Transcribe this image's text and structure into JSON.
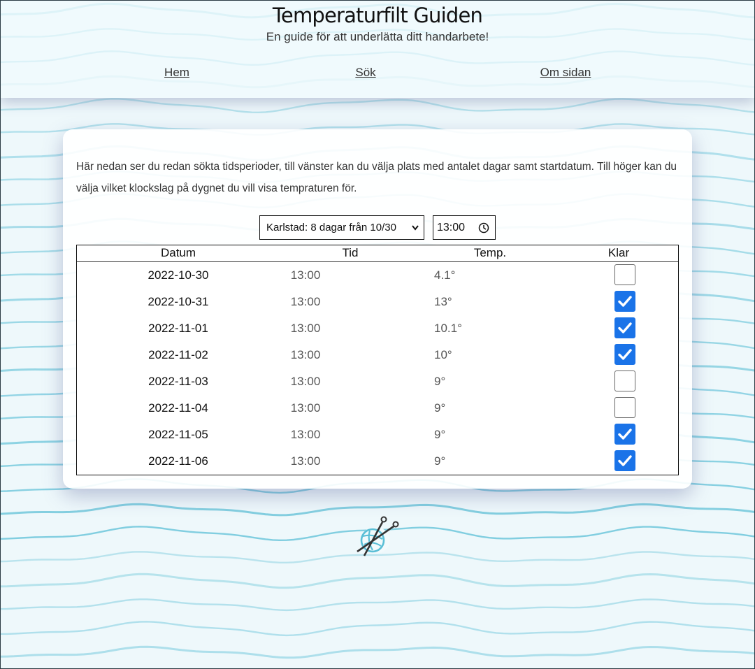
{
  "header": {
    "title": "Temperaturfilt Guiden",
    "subtitle": "En guide för att underlätta ditt handarbete!"
  },
  "nav": [
    {
      "label": "Hem"
    },
    {
      "label": "Sök"
    },
    {
      "label": "Om sidan"
    }
  ],
  "main": {
    "intro": "Här nedan ser du redan sökta tidsperioder, till vänster kan du välja plats med antalet dagar samt startdatum. Till höger kan du välja vilket klockslag på dygnet du vill visa tempraturen för.",
    "period_select": {
      "selected": "Karlstad: 8 dagar från 10/30"
    },
    "time_input": {
      "value": "13:00"
    }
  },
  "table": {
    "headers": {
      "date": "Datum",
      "time": "Tid",
      "temp": "Temp.",
      "done": "Klar"
    },
    "rows": [
      {
        "date": "2022-10-30",
        "time": "13:00",
        "temp": "4.1°",
        "done": false
      },
      {
        "date": "2022-10-31",
        "time": "13:00",
        "temp": "13°",
        "done": true
      },
      {
        "date": "2022-11-01",
        "time": "13:00",
        "temp": "10.1°",
        "done": true
      },
      {
        "date": "2022-11-02",
        "time": "13:00",
        "temp": "10°",
        "done": true
      },
      {
        "date": "2022-11-03",
        "time": "13:00",
        "temp": "9°",
        "done": false
      },
      {
        "date": "2022-11-04",
        "time": "13:00",
        "temp": "9°",
        "done": false
      },
      {
        "date": "2022-11-05",
        "time": "13:00",
        "temp": "9°",
        "done": true
      },
      {
        "date": "2022-11-06",
        "time": "13:00",
        "temp": "9°",
        "done": true
      }
    ]
  },
  "icons": {
    "logo": "yarn-ball-knitting-needles-icon",
    "select_arrow": "chevron-down-icon",
    "time_picker": "clock-icon",
    "checked": "checkmark-icon"
  },
  "colors": {
    "accent": "#1a73e8",
    "wave": "#5bbfd6",
    "background": "#eef8fb"
  }
}
